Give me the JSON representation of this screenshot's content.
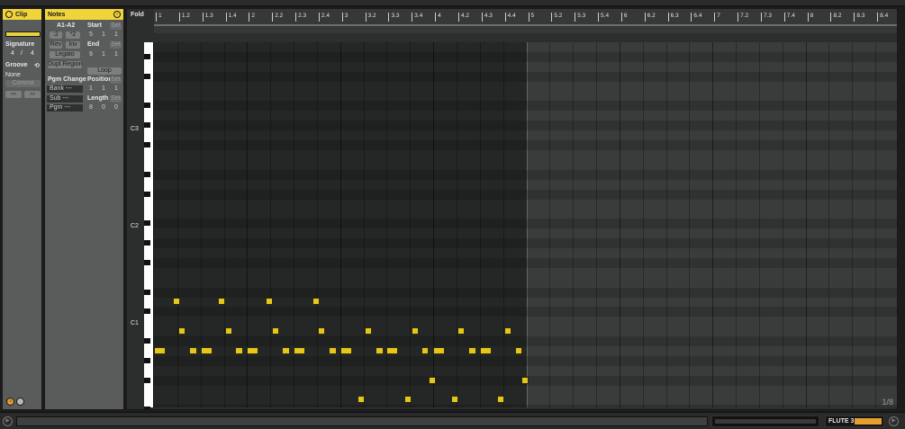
{
  "clip": {
    "header": "Clip",
    "signature_label": "Signature",
    "sig_num": "4",
    "sig_slash": "/",
    "sig_den": "4",
    "groove_label": "Groove",
    "groove_value": "None",
    "commit_label": "Commit",
    "nudge_left": "<<",
    "nudge_right": ">>"
  },
  "notes": {
    "header": "Notes",
    "range": "A1-A2",
    "start_label": "Start",
    "start_set": "Set",
    "start_values": [
      "5",
      "1",
      "1"
    ],
    "end_label": "End",
    "end_set": "Set",
    "end_values": [
      "9",
      "1",
      "1"
    ],
    "half_btn": ":2",
    "double_btn": "*2",
    "rev_btn": "Rev",
    "inv_btn": "Inv",
    "legato_btn": "Legato",
    "dupl_btn": "Dupl.Region",
    "loop_btn": "Loop",
    "pgm_change_label": "Pgm Change",
    "position_label": "Position",
    "position_set": "Set",
    "position_values": [
      "1",
      "1",
      "1"
    ],
    "bank_label": "Bank ---",
    "sub_label": "Sub ---",
    "pgm_label": "Pgm ---",
    "length_label": "Length",
    "length_set": "Set",
    "length_values": [
      "8",
      "0",
      "0"
    ]
  },
  "editor": {
    "fold_label": "Fold",
    "pitch_labels": [
      "C3",
      "C2",
      "C1"
    ],
    "zoom_readout": "1/8",
    "ruler": [
      "1",
      "1.2",
      "1.3",
      "1.4",
      "2",
      "2.2",
      "2.3",
      "2.4",
      "3",
      "3.2",
      "3.3",
      "3.4",
      "4",
      "4.2",
      "4.3",
      "4.4",
      "5",
      "5.2",
      "5.3",
      "5.4",
      "6",
      "6.2",
      "6.3",
      "6.4",
      "7",
      "7.2",
      "7.3",
      "7.4",
      "8",
      "8.2",
      "8.3",
      "8.4"
    ],
    "loop_start_bar": 5,
    "notes_grid": [
      {
        "beat": 0.0,
        "len": 0.5,
        "pitch": "A1"
      },
      {
        "beat": 0.8,
        "len": 0.17,
        "pitch": "D2"
      },
      {
        "beat": 1.05,
        "len": 0.2,
        "pitch": "B1"
      },
      {
        "beat": 1.5,
        "len": 0.35,
        "pitch": "A1"
      },
      {
        "beat": 2.0,
        "len": 0.5,
        "pitch": "A1"
      },
      {
        "beat": 2.75,
        "len": 0.2,
        "pitch": "D2"
      },
      {
        "beat": 3.05,
        "len": 0.2,
        "pitch": "B1"
      },
      {
        "beat": 3.5,
        "len": 0.35,
        "pitch": "A1"
      },
      {
        "beat": 4.0,
        "len": 0.5,
        "pitch": "A1"
      },
      {
        "beat": 4.8,
        "len": 0.2,
        "pitch": "D2"
      },
      {
        "beat": 5.05,
        "len": 0.2,
        "pitch": "B1"
      },
      {
        "beat": 5.5,
        "len": 0.35,
        "pitch": "A1"
      },
      {
        "beat": 6.0,
        "len": 0.5,
        "pitch": "A1"
      },
      {
        "beat": 6.8,
        "len": 0.2,
        "pitch": "D2"
      },
      {
        "beat": 7.05,
        "len": 0.2,
        "pitch": "B1"
      },
      {
        "beat": 7.5,
        "len": 0.35,
        "pitch": "A1"
      },
      {
        "beat": 8.0,
        "len": 0.5,
        "pitch": "A1"
      },
      {
        "beat": 8.75,
        "len": 0.2,
        "pitch": "E1"
      },
      {
        "beat": 9.05,
        "len": 0.2,
        "pitch": "B1"
      },
      {
        "beat": 9.5,
        "len": 0.35,
        "pitch": "A1"
      },
      {
        "beat": 10.0,
        "len": 0.5,
        "pitch": "A1"
      },
      {
        "beat": 10.75,
        "len": 0.2,
        "pitch": "E1"
      },
      {
        "beat": 11.05,
        "len": 0.2,
        "pitch": "B1"
      },
      {
        "beat": 11.5,
        "len": 0.2,
        "pitch": "A1"
      },
      {
        "beat": 11.8,
        "len": 0.15,
        "pitch": "F#1"
      },
      {
        "beat": 12.0,
        "len": 0.5,
        "pitch": "A1"
      },
      {
        "beat": 12.75,
        "len": 0.2,
        "pitch": "E1"
      },
      {
        "beat": 13.05,
        "len": 0.2,
        "pitch": "B1"
      },
      {
        "beat": 13.5,
        "len": 0.35,
        "pitch": "A1"
      },
      {
        "beat": 14.0,
        "len": 0.5,
        "pitch": "A1"
      },
      {
        "beat": 14.75,
        "len": 0.2,
        "pitch": "E1"
      },
      {
        "beat": 15.05,
        "len": 0.2,
        "pitch": "B1"
      },
      {
        "beat": 15.5,
        "len": 0.25,
        "pitch": "A1"
      },
      {
        "beat": 15.8,
        "len": 0.2,
        "pitch": "F#1"
      }
    ]
  },
  "bottom": {
    "play_icon": "play-icon",
    "track_name": "FLUTE 3",
    "end_icon": "circle-play-icon"
  }
}
